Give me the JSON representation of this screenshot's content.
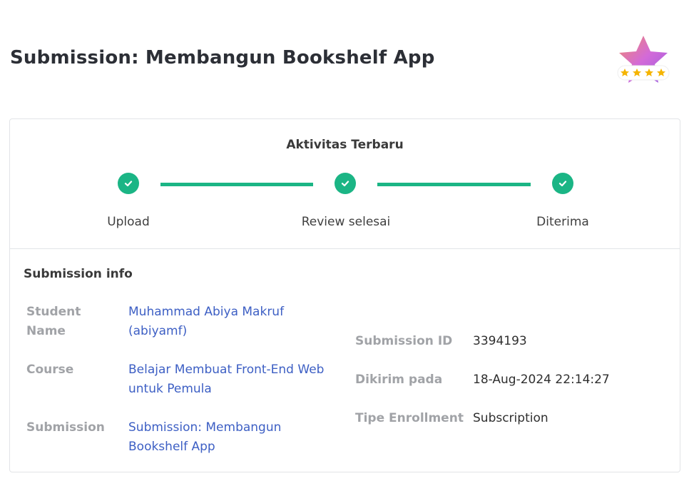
{
  "page": {
    "title": "Submission: Membangun Bookshelf App"
  },
  "rating_badge": {
    "icon": "star-rating-badge-icon",
    "stars": 4
  },
  "activity": {
    "title": "Aktivitas Terbaru",
    "steps": [
      {
        "label": "Upload",
        "status": "done"
      },
      {
        "label": "Review selesai",
        "status": "done"
      },
      {
        "label": "Diterima",
        "status": "done"
      }
    ],
    "accent_color": "#1bb585"
  },
  "submission_info": {
    "title": "Submission info",
    "student_name_label": "Student Name",
    "student_name_value": "Muhammad Abiya Makruf (abiyamf)",
    "course_label": "Course",
    "course_value": "Belajar Membuat Front-End Web untuk Pemula",
    "submission_label": "Submission",
    "submission_value": "Submission: Membangun Bookshelf App",
    "submission_id_label": "Submission ID",
    "submission_id_value": "3394193",
    "sent_at_label": "Dikirim pada",
    "sent_at_value": "18-Aug-2024 22:14:27",
    "enrollment_label": "Tipe Enrollment",
    "enrollment_value": "Subscription"
  },
  "colors": {
    "link": "#3d5fc4",
    "label": "#a1a3a7",
    "success": "#1bb585"
  }
}
